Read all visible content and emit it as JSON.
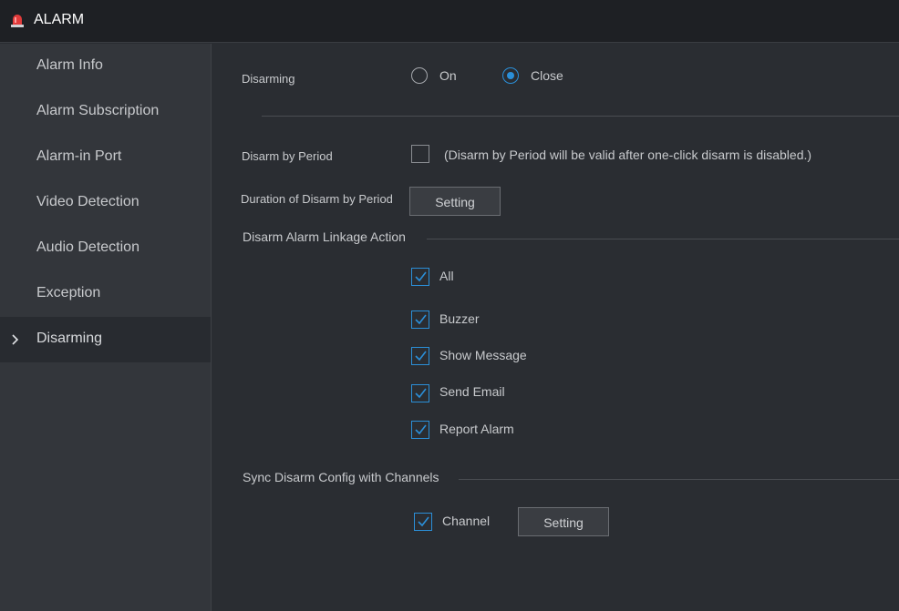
{
  "header": {
    "title": "ALARM",
    "icon": "alarm-light-icon"
  },
  "sidebar": {
    "items": [
      {
        "label": "Alarm Info",
        "active": false
      },
      {
        "label": "Alarm Subscription",
        "active": false
      },
      {
        "label": "Alarm-in Port",
        "active": false
      },
      {
        "label": "Video Detection",
        "active": false
      },
      {
        "label": "Audio Detection",
        "active": false
      },
      {
        "label": "Exception",
        "active": false
      },
      {
        "label": "Disarming",
        "active": true
      }
    ]
  },
  "disarming": {
    "label": "Disarming",
    "options": [
      {
        "label": "On",
        "selected": false
      },
      {
        "label": "Close",
        "selected": true
      }
    ]
  },
  "disarm_by_period": {
    "label": "Disarm by Period",
    "checked": false,
    "note": "(Disarm by Period will be valid after one-click disarm is disabled.)"
  },
  "duration": {
    "label": "Duration of Disarm by Period",
    "button": "Setting"
  },
  "linkage": {
    "section_title": "Disarm Alarm Linkage Action",
    "items": [
      {
        "label": "All",
        "checked": true
      },
      {
        "label": "Buzzer",
        "checked": true
      },
      {
        "label": "Show Message",
        "checked": true
      },
      {
        "label": "Send Email",
        "checked": true
      },
      {
        "label": "Report Alarm",
        "checked": true
      }
    ]
  },
  "sync": {
    "section_title": "Sync Disarm Config with Channels",
    "channel_label": "Channel",
    "channel_checked": true,
    "button": "Setting"
  },
  "colors": {
    "accent": "#2b8fd8",
    "background": "#2a2d32",
    "sidebar": "#33363b",
    "header": "#1e2024"
  }
}
